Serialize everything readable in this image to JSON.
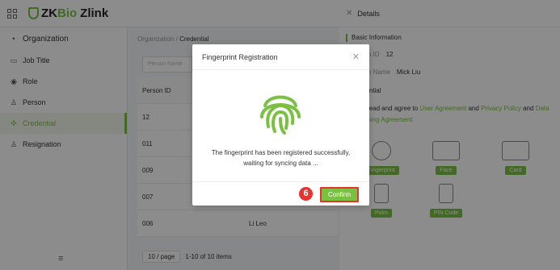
{
  "app": {
    "logo_zk": "ZK",
    "logo_bio": "Bio",
    "logo_zlink": "Zlink"
  },
  "sidebar": {
    "items": [
      {
        "label": "Organization",
        "icon": "org-icon"
      },
      {
        "label": "Job Title",
        "icon": "briefcase-icon"
      },
      {
        "label": "Role",
        "icon": "role-icon"
      },
      {
        "label": "Person",
        "icon": "person-icon"
      },
      {
        "label": "Credential",
        "icon": "credential-icon"
      },
      {
        "label": "Resignation",
        "icon": "resignation-icon"
      }
    ],
    "collapse_icon": "≡"
  },
  "main": {
    "breadcrumb_root": "Organization",
    "breadcrumb_sep": "/",
    "breadcrumb_current": "Credential",
    "search_placeholder": "Person Name",
    "table": {
      "header": [
        "Person ID",
        ""
      ],
      "rows": [
        [
          "12",
          ""
        ],
        [
          "011",
          ""
        ],
        [
          "009",
          ""
        ],
        [
          "007",
          ""
        ],
        [
          "006",
          "Li Leo"
        ]
      ]
    },
    "pager": {
      "page_size": "10 / page",
      "range": "1-10 of 10 items"
    }
  },
  "details": {
    "title": "Details",
    "basic_info_title": "Basic Information",
    "person_id_label": "Person ID",
    "person_id_value": "12",
    "person_name_label": "Person Name",
    "person_name_value": "Mick Liu",
    "credential_title": "Credential",
    "agree_prefix": "I have read and agree to",
    "agree_link1": "User Agreement",
    "agree_and": "and",
    "agree_link2": "Privacy Policy",
    "agree_and2": "and",
    "agree_link3": "Data Processing Agreement",
    "credentials": [
      "Fingerprint",
      "Face",
      "Card",
      "Palm",
      "PIN Code"
    ]
  },
  "modal": {
    "title": "Fingerprint Registration",
    "message_line1": "The fingerprint has been registered successfully,",
    "message_line2": "waiting for syncing data ...",
    "confirm_label": "Confirm",
    "step_number": "6"
  },
  "colors": {
    "accent": "#7ac143",
    "highlight": "#e8322d"
  }
}
